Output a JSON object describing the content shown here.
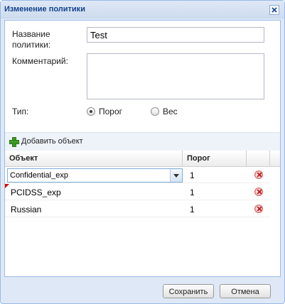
{
  "window": {
    "title": "Изменение политики"
  },
  "form": {
    "name_label": "Название политики:",
    "name_value": "Test",
    "comment_label": "Комментарий:",
    "comment_value": "",
    "type_label": "Тип:",
    "type_options": [
      {
        "label": "Порог",
        "checked": true
      },
      {
        "label": "Вес",
        "checked": false
      }
    ]
  },
  "toolbar": {
    "add_label": "Добавить объект"
  },
  "grid": {
    "columns": [
      "Объект",
      "Порог"
    ],
    "rows": [
      {
        "object": "Confidential_exp",
        "threshold": "1",
        "editing": true
      },
      {
        "object": "PCIDSS_exp",
        "threshold": "1",
        "dirty": true
      },
      {
        "object": "Russian",
        "threshold": "1"
      }
    ]
  },
  "footer": {
    "save_label": "Сохранить",
    "cancel_label": "Отмена"
  }
}
